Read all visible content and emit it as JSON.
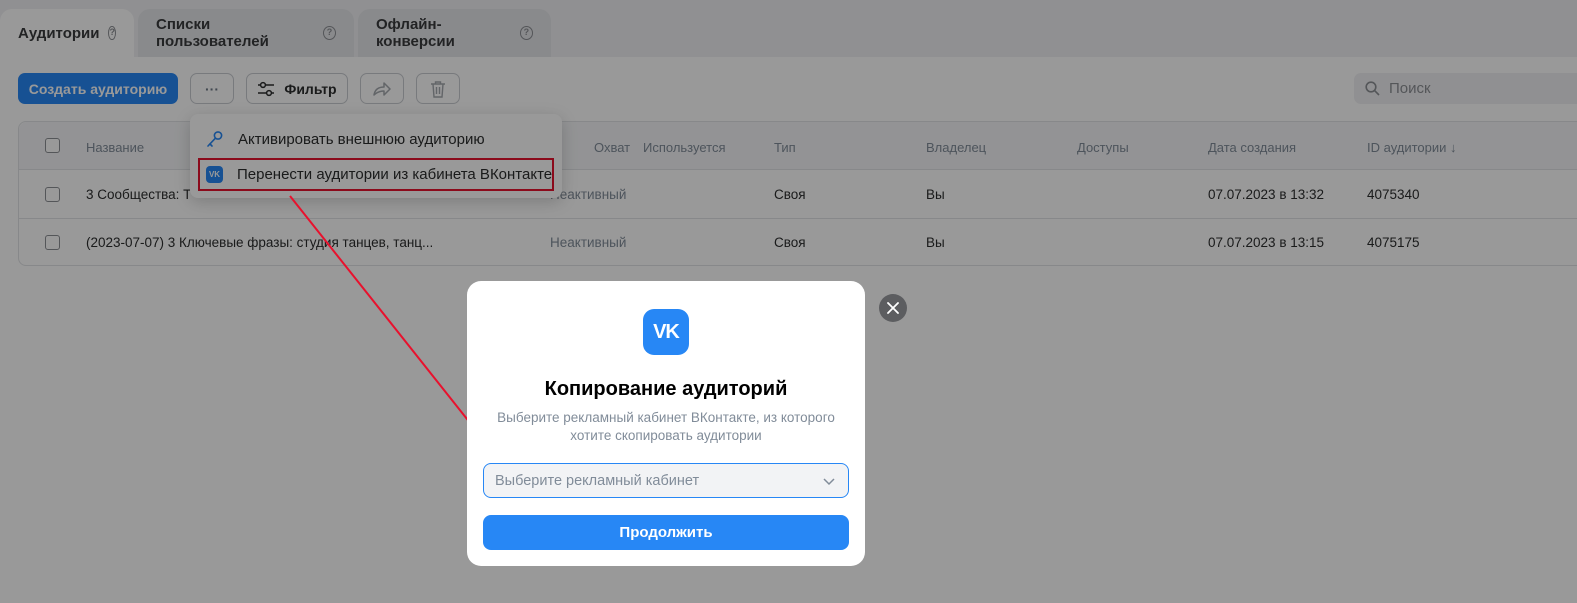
{
  "tabs": [
    {
      "label": "Аудитории",
      "help": "?"
    },
    {
      "label": "Списки пользователей",
      "help": "?"
    },
    {
      "label": "Офлайн-конверсии",
      "help": "?"
    }
  ],
  "toolbar": {
    "create_label": "Создать аудиторию",
    "more_label": "···",
    "filter_label": "Фильтр",
    "search_placeholder": "Поиск"
  },
  "table": {
    "columns": [
      "Название",
      "Охват",
      "Используется",
      "Тип",
      "Владелец",
      "Доступы",
      "Дата создания",
      "ID аудитории ↓"
    ],
    "rows": [
      {
        "name": "3 Сообщества: Т",
        "reach": "Неактивный",
        "used": "",
        "type": "Своя",
        "owner": "Вы",
        "access": "",
        "created": "07.07.2023 в 13:32",
        "id": "4075340"
      },
      {
        "name": "(2023-07-07) 3 Ключевые фразы: студия танцев, танц...",
        "reach": "Неактивный",
        "used": "",
        "type": "Своя",
        "owner": "Вы",
        "access": "",
        "created": "07.07.2023 в 13:15",
        "id": "4075175"
      }
    ]
  },
  "dropdown": {
    "items": [
      {
        "label": "Активировать внешнюю аудиторию",
        "icon": "key-icon"
      },
      {
        "label": "Перенести аудитории из кабинета ВКонтакте",
        "icon": "vk-icon",
        "vk_text": "VK"
      }
    ]
  },
  "modal": {
    "logo": "VK",
    "title": "Копирование аудиторий",
    "description_line1": "Выберите рекламный кабинет ВКонтакте, из которого",
    "description_line2": "хотите скопировать аудитории",
    "select_placeholder": "Выберите рекламный кабинет",
    "continue_label": "Продолжить"
  },
  "colors": {
    "accent": "#2787f5",
    "annotation": "#e8112d"
  }
}
